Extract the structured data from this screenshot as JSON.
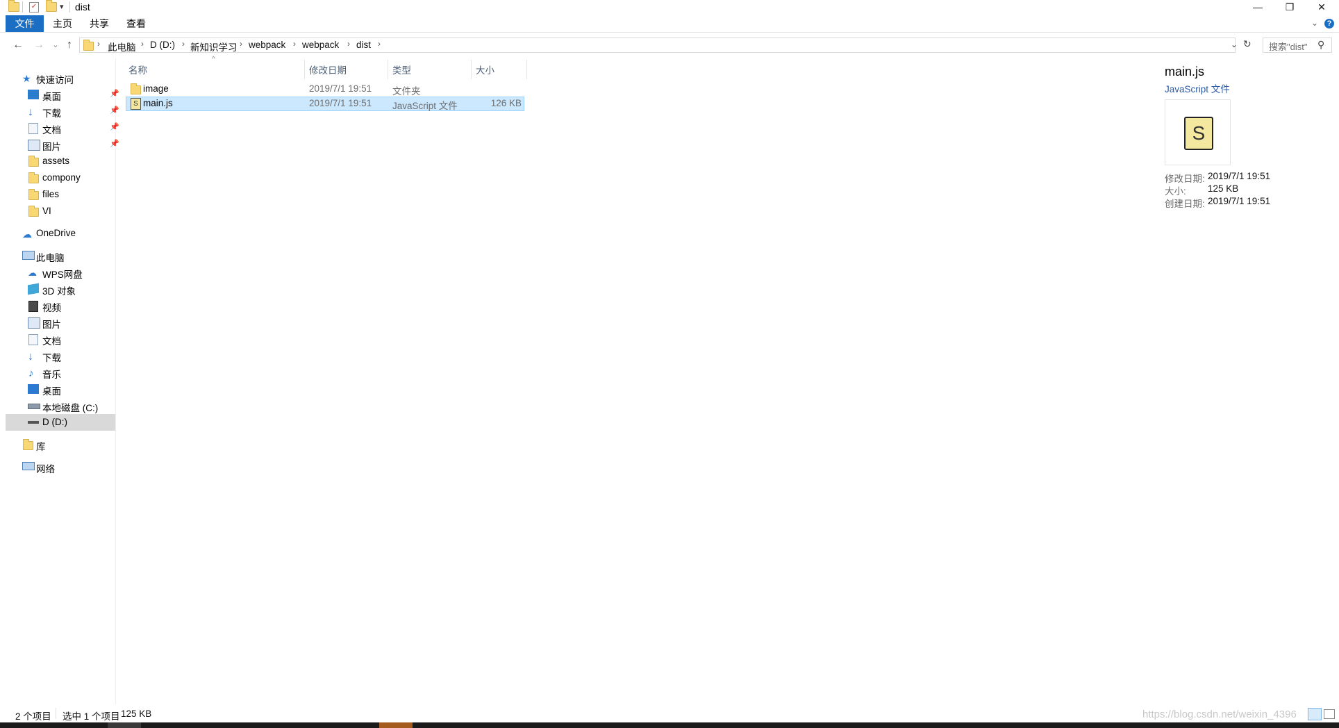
{
  "window": {
    "title": "dist",
    "controls": {
      "minimize": "—",
      "restore": "❐",
      "close": "✕"
    }
  },
  "ribbon": {
    "tabs": [
      "文件",
      "主页",
      "共享",
      "查看"
    ]
  },
  "address": {
    "crumbs": [
      "此电脑",
      "D (D:)",
      "新知识学习",
      "webpack",
      "webpack",
      "dist"
    ],
    "search_placeholder": "搜索\"dist\""
  },
  "navpane": {
    "quick_access": "快速访问",
    "quick_items": [
      "桌面",
      "下载",
      "文档",
      "图片",
      "assets",
      "compony",
      "files",
      "VI"
    ],
    "onedrive": "OneDrive",
    "this_pc": "此电脑",
    "pc_items": [
      "WPS网盘",
      "3D 对象",
      "视频",
      "图片",
      "文档",
      "下载",
      "音乐",
      "桌面",
      "本地磁盘 (C:)",
      "D (D:)"
    ],
    "library": "库",
    "network": "网络"
  },
  "filelist": {
    "columns": {
      "name": "名称",
      "modified": "修改日期",
      "type": "类型",
      "size": "大小"
    },
    "rows": [
      {
        "name": "image",
        "modified": "2019/7/1 19:51",
        "type": "文件夹",
        "size": ""
      },
      {
        "name": "main.js",
        "modified": "2019/7/1 19:51",
        "type": "JavaScript 文件",
        "size": "126 KB"
      }
    ]
  },
  "preview": {
    "name": "main.js",
    "type": "JavaScript 文件",
    "modified_label": "修改日期:",
    "modified_value": "2019/7/1 19:51",
    "size_label": "大小:",
    "size_value": "125 KB",
    "created_label": "创建日期:",
    "created_value": "2019/7/1 19:51"
  },
  "status": {
    "count": "2 个项目",
    "selected": "选中 1 个项目",
    "selected_size": "125 KB"
  },
  "watermark": "https://blog.csdn.net/weixin_4396"
}
